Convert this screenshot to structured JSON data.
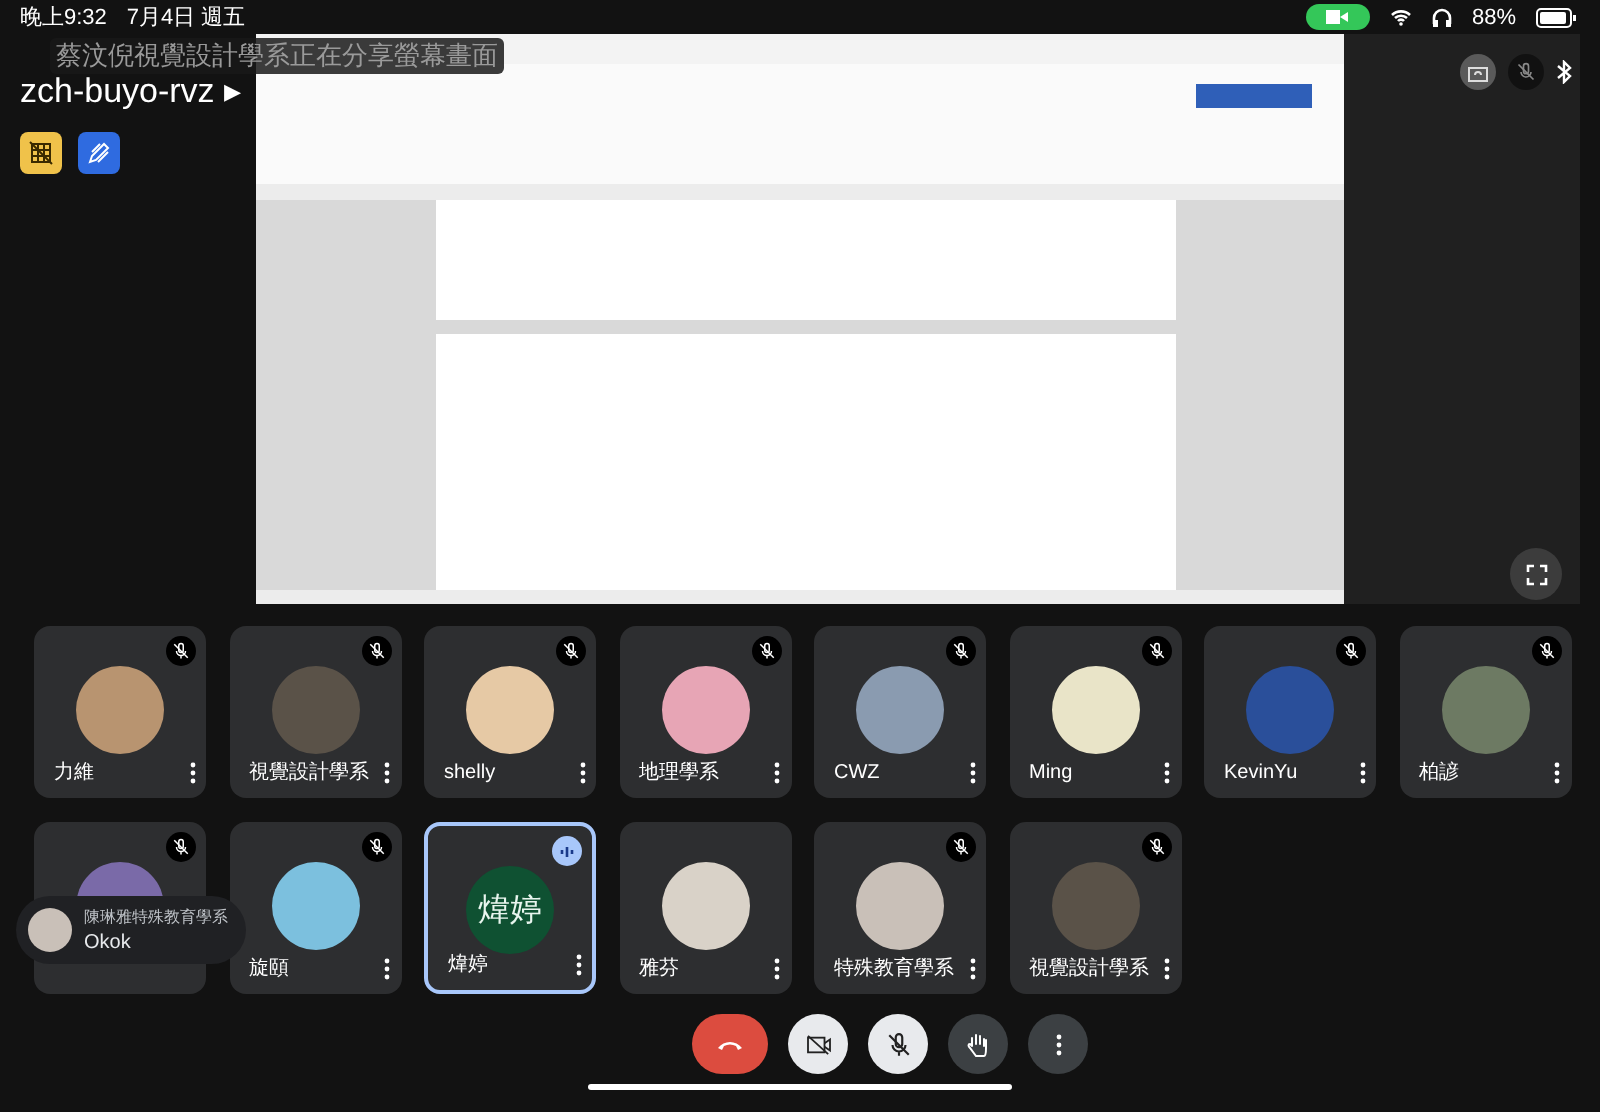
{
  "status_bar": {
    "time": "晚上9:32",
    "date": "7月4日 週五",
    "camera_active": true,
    "battery": "88%"
  },
  "meeting": {
    "code": "zch-buyo-rvz",
    "expand_glyph": "▸"
  },
  "share_banner": "蔡汶倪視覺設計學系正在分享螢幕畫面",
  "participants": [
    {
      "name": "力維",
      "muted": true,
      "speaking": false,
      "avatar": {
        "kind": "photo"
      }
    },
    {
      "name": "視覺設計學系",
      "muted": true,
      "speaking": false,
      "avatar": {
        "kind": "photo"
      }
    },
    {
      "name": "shelly",
      "muted": true,
      "speaking": false,
      "avatar": {
        "kind": "photo"
      }
    },
    {
      "name": "地理學系",
      "muted": true,
      "speaking": false,
      "avatar": {
        "kind": "photo"
      }
    },
    {
      "name": "CWZ",
      "muted": true,
      "speaking": false,
      "avatar": {
        "kind": "photo"
      }
    },
    {
      "name": "Ming",
      "muted": true,
      "speaking": false,
      "avatar": {
        "kind": "photo"
      }
    },
    {
      "name": "KevinYu",
      "muted": true,
      "speaking": false,
      "avatar": {
        "kind": "photo"
      }
    },
    {
      "name": "柏諺",
      "muted": true,
      "speaking": false,
      "avatar": {
        "kind": "photo"
      }
    },
    {
      "muted": true,
      "speaking": false,
      "avatar": {
        "kind": "photo"
      }
    },
    {
      "name": "旋頤",
      "muted": true,
      "speaking": false,
      "avatar": {
        "kind": "photo"
      }
    },
    {
      "name": "煒婷",
      "muted": false,
      "speaking": true,
      "avatar": {
        "kind": "initials",
        "text": "煒婷"
      }
    },
    {
      "name": "雅芬",
      "muted": false,
      "speaking": false,
      "avatar": {
        "kind": "photo"
      }
    },
    {
      "name": "特殊教育學系",
      "muted": true,
      "speaking": false,
      "avatar": {
        "kind": "photo"
      }
    },
    {
      "name": "視覺設計學系",
      "muted": true,
      "speaking": false,
      "avatar": {
        "kind": "photo"
      }
    }
  ],
  "chat_bubble": {
    "sender": "陳琳雅特殊教育學系",
    "message": "Okok"
  },
  "controls": [
    {
      "kind": "hangup"
    },
    {
      "kind": "camera",
      "on": false
    },
    {
      "kind": "mic",
      "on": false
    },
    {
      "kind": "hand"
    },
    {
      "kind": "more"
    }
  ]
}
